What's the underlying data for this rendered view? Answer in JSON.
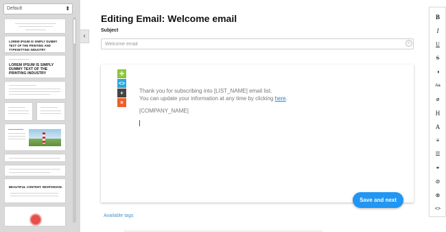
{
  "sidebar": {
    "select_value": "Default",
    "thumbnails": {
      "t2_text": "LOREM IPSUM IS SIMPLY DUMMY TEXT OF THE PRINTING AND TYPESETTING INDUSTRY",
      "t3_text": "LOREM IPSUM IS SIMPLY DUMMY TEXT OF THE PRINTING INDUSTRY",
      "t8_text": "BEAUTIFUL CONTENT. RESPONSIVE."
    }
  },
  "header": {
    "title": "Editing Email: Welcome email",
    "subject_label": "Subject",
    "subject_value": "Welcome email"
  },
  "editor": {
    "line1": "Thank you for subscribing into [LIST_NAME] email list.",
    "line2_prefix": "You can update your information at any time by clicking ",
    "line2_link": "here",
    "line2_suffix": ".",
    "company": "[COMPANY_NAME]",
    "tools": {
      "move": "✣",
      "code": "<>",
      "add": "+",
      "delete": "×"
    }
  },
  "save_button": "Save and next",
  "available_tags": "Available tags",
  "right_toolbar": [
    "B",
    "I",
    "U",
    "S",
    "◑",
    "Aa",
    "⌀",
    "H",
    "A",
    "≡",
    "☰",
    "⚭",
    "⊘",
    "⊗",
    "<>"
  ],
  "colors": {
    "accent": "#2196f3",
    "tool_move": "#8cc63f",
    "tool_code": "#29a8e0",
    "tool_add": "#444444",
    "tool_delete": "#e8622c"
  }
}
